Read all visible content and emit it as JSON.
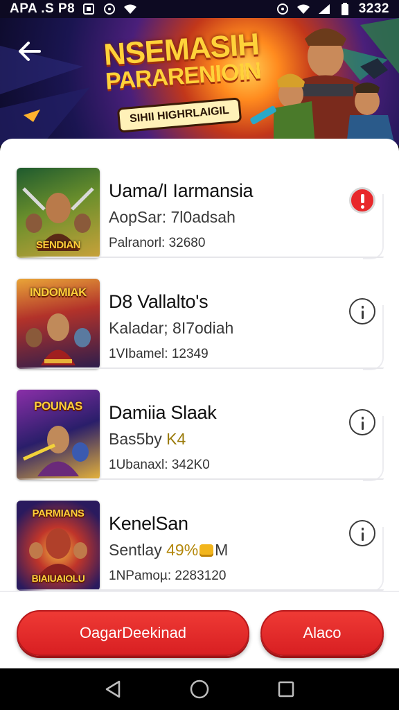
{
  "status_bar": {
    "carrier_text": "APA .S P8",
    "time": "3232",
    "icons": [
      "box-icon",
      "circle-icon",
      "wifi-icon",
      "do-not-disturb-icon",
      "wifi-icon",
      "signal-icon",
      "battery-icon"
    ]
  },
  "banner": {
    "title_line1": "NSEMASIH",
    "title_line2": "PARARENIOIN",
    "badge": "SIHII HIGHRLAIGIL",
    "back_icon": "arrow-left-icon"
  },
  "games": [
    {
      "title": "Uama/I Iarmansia",
      "subtitle": "AopSar: 7l0adsah",
      "meta": "Palranorl: 32680",
      "thumb_label": "SENDIAN",
      "thumb_position": "bottom",
      "thumb_colors": [
        "#1e5a2e",
        "#6b8f2c",
        "#c9a23a"
      ],
      "action_icon": "alert-icon",
      "action_color": "#e8282b"
    },
    {
      "title": "D8 Vallalto's",
      "subtitle": "Kaladar; 8I7odiah",
      "meta": "1VIbamel: 12349",
      "thumb_label": "INDOMIAK",
      "thumb_position": "top",
      "thumb_colors": [
        "#2b1d4d",
        "#b2322a",
        "#e9a538"
      ],
      "action_icon": "info-icon"
    },
    {
      "title": "Damiia Slaak",
      "subtitle_text": "Bas5by",
      "subtitle_accent": "K4",
      "meta": "1Ubanaxl: 342K0",
      "thumb_label": "POUNAS",
      "thumb_position": "top",
      "thumb_colors": [
        "#2a1e6a",
        "#8a2fa8",
        "#e7b43a"
      ],
      "action_icon": "info-icon"
    },
    {
      "title": "KenelSan",
      "subtitle_pre": "Sentlay",
      "subtitle_accent": "49%",
      "subtitle_post": "M",
      "meta": "1NPamoµ: 2283120",
      "thumb_label": "PARMIANS",
      "thumb_label_bottom": "BIAIUAIOLU",
      "thumb_position": "top",
      "thumb_colors": [
        "#2a1a5e",
        "#c0352a",
        "#f0b640"
      ],
      "action_icon": "info-icon"
    }
  ],
  "actions": {
    "primary_label": "OagarDeekinad",
    "secondary_label": "Alaco"
  },
  "nav": {
    "back": "triangle-back-icon",
    "home": "circle-home-icon",
    "recents": "square-recents-icon"
  },
  "colors": {
    "accent_red": "#e8282b",
    "banner_yellow": "#ffd23a",
    "accent_gold": "#b3870a"
  }
}
